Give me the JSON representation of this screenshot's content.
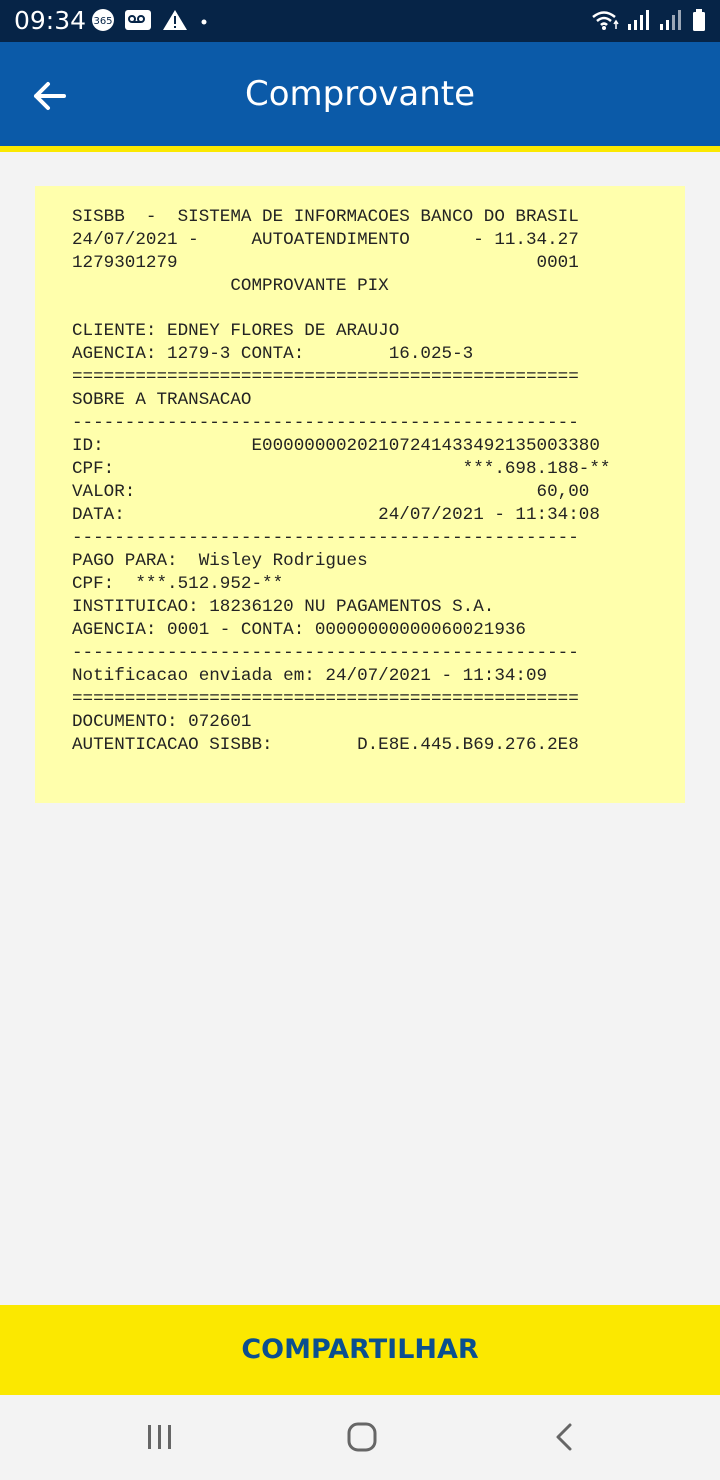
{
  "status_bar": {
    "time": "09:34",
    "left_icons": [
      "365-icon",
      "voicemail-icon",
      "warning-icon",
      "dot-icon"
    ],
    "right_icons": [
      "wifi-icon",
      "signal-icon",
      "signal-icon",
      "battery-icon"
    ]
  },
  "header": {
    "title": "Comprovante",
    "back_icon": "arrow-left-icon"
  },
  "receipt": {
    "lines": [
      "SISBB  -  SISTEMA DE INFORMACOES BANCO DO BRASIL",
      "24/07/2021 -     AUTOATENDIMENTO      - 11.34.27",
      "1279301279                                  0001",
      "               COMPROVANTE PIX",
      "",
      "CLIENTE: EDNEY FLORES DE ARAUJO",
      "AGENCIA: 1279-3 CONTA:        16.025-3",
      "================================================",
      "SOBRE A TRANSACAO",
      "------------------------------------------------",
      "ID:              E00000000202107241433492135003380",
      "CPF:                                 ***.698.188-**",
      "VALOR:                                      60,00",
      "DATA:                        24/07/2021 - 11:34:08",
      "------------------------------------------------",
      "PAGO PARA:  Wisley Rodrigues",
      "CPF:  ***.512.952-**",
      "INSTITUICAO: 18236120 NU PAGAMENTOS S.A.",
      "AGENCIA: 0001 - CONTA: 00000000000060021936",
      "------------------------------------------------",
      "Notificacao enviada em: 24/07/2021 - 11:34:09",
      "================================================",
      "DOCUMENTO: 072601",
      "AUTENTICACAO SISBB:        D.E8E.445.B69.276.2E8"
    ]
  },
  "share_button": {
    "label": "COMPARTILHAR"
  },
  "nav_bar": {
    "items": [
      "recent-apps-icon",
      "home-icon",
      "back-icon"
    ]
  },
  "colors": {
    "status_bar": "#062447",
    "app_bar": "#0b5aa8",
    "accent_yellow": "#fbe800",
    "receipt_bg": "#ffffac",
    "button_text": "#0b4f8f"
  }
}
